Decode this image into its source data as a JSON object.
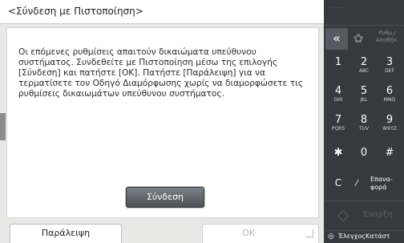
{
  "screen": {
    "title": "<Σύνδεση με Πιστοποίηση>",
    "message": "Οι επόμενες ρυθμίσεις απαιτούν δικαιώματα υπεύθυνου συστήματος. Συνδεθείτε με Πιστοποίηση μέσω της επιλογής [Σύνδεση] και πατήστε [OK]. Πατήστε [Παράλειψη] για να τερματίσετε τον Οδηγό Διαμόρφωσης χωρίς να διαμορφώσετε τις ρυθμίσεις δικαιωμάτων υπεύθυνου συστήματος.",
    "connect_label": "Σύνδεση",
    "skip_label": "Παράλειψη",
    "ok_label": "OK"
  },
  "panel": {
    "top_dots": "·····",
    "back_icon": "back-icon",
    "back_glyph": "«",
    "settings_icon": "gear-icon",
    "settings_glyph": "✿",
    "settings_label": "Ρυθμ./ Αποθήκ.",
    "keys": [
      {
        "digit": "1",
        "letters": ""
      },
      {
        "digit": "2",
        "letters": "ABC"
      },
      {
        "digit": "3",
        "letters": "DEF"
      },
      {
        "digit": "4",
        "letters": "GHI"
      },
      {
        "digit": "5",
        "letters": "JKL"
      },
      {
        "digit": "6",
        "letters": "MNO"
      },
      {
        "digit": "7",
        "letters": "PQRS"
      },
      {
        "digit": "8",
        "letters": "TUV"
      },
      {
        "digit": "9",
        "letters": "WXYZ"
      },
      {
        "digit": "✱",
        "letters": ""
      },
      {
        "digit": "0",
        "letters": ""
      },
      {
        "digit": "#",
        "letters": ""
      }
    ],
    "clear_label": "C",
    "correct_glyph": "⁄",
    "correct_label": "Επανα- φορά",
    "start_glyph": "◇",
    "start_label": "Έναρξη",
    "status_glyph": "◎",
    "status_label": "ΈλεγχοςΚατάστ"
  },
  "colors": {
    "screen_bg": "#e8e8e6",
    "panel_bg": "#36393d",
    "connect_button": "#5f636a",
    "disabled_text": "#b5b5b5"
  }
}
